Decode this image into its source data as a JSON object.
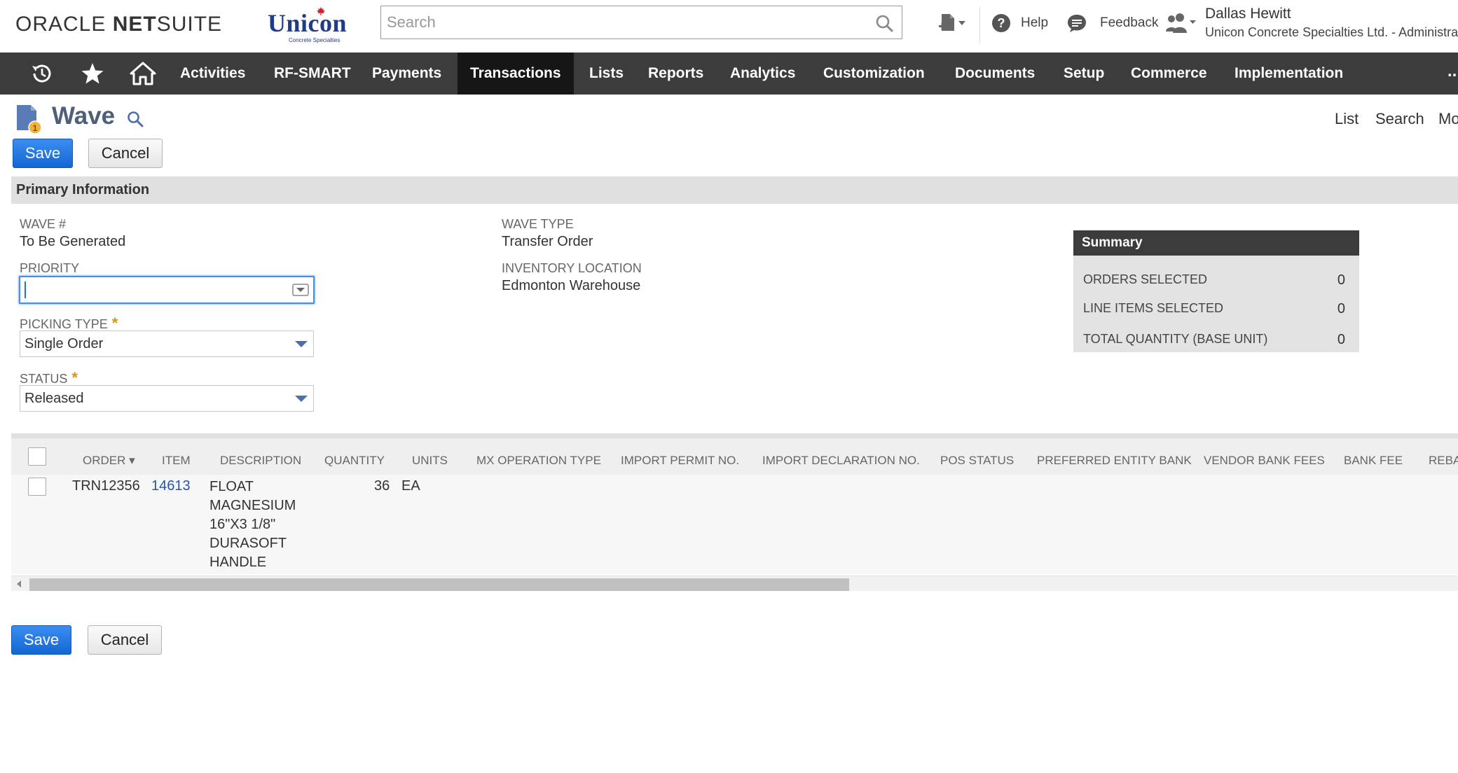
{
  "header": {
    "oracle_bold": "ORACLE",
    "netsuite_bold": "NET",
    "netsuite_light": "SUITE",
    "company_logo_name": "Unicon",
    "company_logo_tagline": "Concrete Specialties",
    "search_placeholder": "Search",
    "help_label": "Help",
    "feedback_label": "Feedback",
    "user_name": "Dallas Hewitt",
    "user_role": "Unicon Concrete Specialties Ltd. - Administrator"
  },
  "nav": {
    "items": [
      "Activities",
      "RF-SMART",
      "Payments",
      "Transactions",
      "Lists",
      "Reports",
      "Analytics",
      "Customization",
      "Documents",
      "Setup",
      "Commerce",
      "Implementation"
    ],
    "active": "Transactions",
    "more": "..."
  },
  "page": {
    "title": "Wave",
    "links": [
      "List",
      "Search",
      "More"
    ]
  },
  "buttons": {
    "save": "Save",
    "cancel": "Cancel"
  },
  "primary": {
    "section_title": "Primary Information",
    "wave_no_label": "WAVE #",
    "wave_no_value": "To Be Generated",
    "priority_label": "PRIORITY",
    "priority_value": "",
    "picking_type_label": "PICKING TYPE",
    "picking_type_value": "Single Order",
    "status_label": "STATUS",
    "status_value": "Released",
    "wave_type_label": "WAVE TYPE",
    "wave_type_value": "Transfer Order",
    "inventory_location_label": "INVENTORY LOCATION",
    "inventory_location_value": "Edmonton Warehouse",
    "required_mark": "*"
  },
  "summary": {
    "title": "Summary",
    "rows": [
      {
        "label": "ORDERS SELECTED",
        "value": "0"
      },
      {
        "label": "LINE ITEMS SELECTED",
        "value": "0"
      },
      {
        "label": "TOTAL QUANTITY (BASE UNIT)",
        "value": "0"
      }
    ]
  },
  "table": {
    "columns": [
      "ORDER ▾",
      "ITEM",
      "DESCRIPTION",
      "QUANTITY",
      "UNITS",
      "MX OPERATION TYPE",
      "IMPORT PERMIT NO.",
      "IMPORT DECLARATION NO.",
      "POS STATUS",
      "PREFERRED ENTITY BANK",
      "VENDOR BANK FEES",
      "BANK FEE",
      "REBATE"
    ],
    "rows": [
      {
        "order": "TRN12356",
        "item": "14613",
        "description_lines": [
          "FLOAT",
          "MAGNESIUM",
          "16\"X3 1/8\"",
          "DURASOFT",
          "HANDLE"
        ],
        "quantity": "36",
        "units": "EA"
      }
    ]
  },
  "colors": {
    "nav_bg": "#3c3c3c",
    "nav_active": "#161616",
    "primary_button": "#1a73e8",
    "title_color": "#4d5f79",
    "required": "#d7951a",
    "link": "#2557a7"
  }
}
